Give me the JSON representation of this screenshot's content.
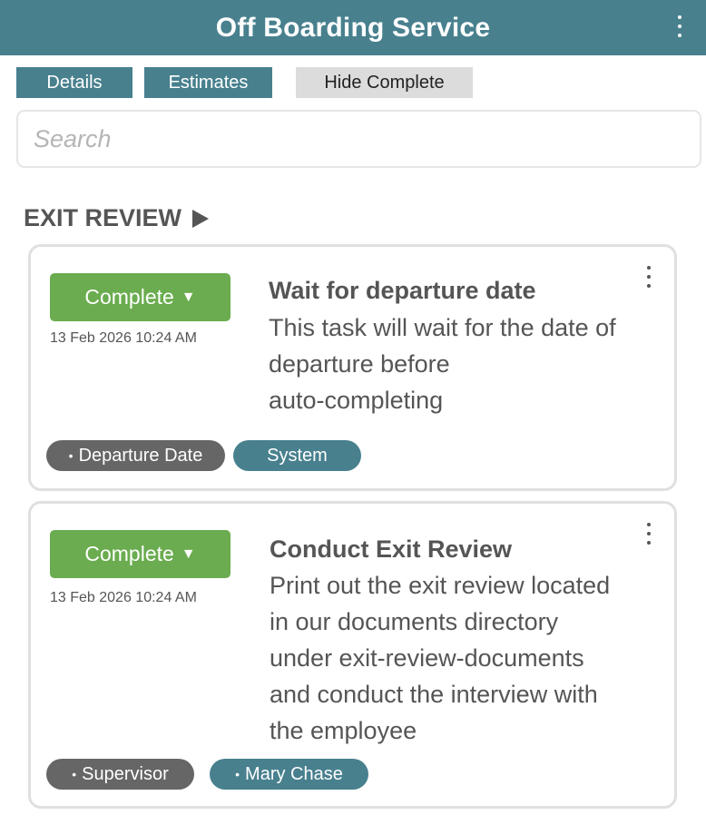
{
  "app": {
    "title": "Off Boarding Service"
  },
  "toolbar": {
    "details_label": "Details",
    "estimates_label": "Estimates",
    "hide_complete_label": "Hide Complete"
  },
  "search": {
    "placeholder": "Search",
    "value": ""
  },
  "section": {
    "title": "EXIT REVIEW"
  },
  "tasks": [
    {
      "status": "Complete",
      "timestamp": "13 Feb 2026 10:24 AM",
      "title": "Wait for departure date",
      "description_lines": [
        "This task will wait for the date of",
        "departure before",
        "auto-completing"
      ],
      "tags": [
        {
          "label": "Departure Date",
          "bullet": true,
          "style": "gray"
        },
        {
          "label": "System",
          "bullet": false,
          "style": "teal"
        }
      ]
    },
    {
      "status": "Complete",
      "timestamp": "13 Feb 2026 10:24 AM",
      "title": "Conduct Exit Review",
      "description_lines": [
        "Print out the exit review located",
        "in our documents directory",
        "under exit-review-documents",
        "and conduct the interview with",
        "the employee"
      ],
      "tags": [
        {
          "label": "Supervisor",
          "bullet": true,
          "style": "gray"
        },
        {
          "label": "Mary Chase",
          "bullet": true,
          "style": "teal"
        }
      ]
    }
  ],
  "colors": {
    "header": "#48808e",
    "status_complete": "#6aac4f",
    "chip_gray": "#666666",
    "chip_teal": "#48808e",
    "toolbar_light": "#dcdcdc"
  },
  "icons": {
    "menu": "more-vertical-icon",
    "section_toggle": "triangle-right-icon",
    "status_dropdown": "caret-down-icon",
    "tag_bullet": "bullet-icon"
  }
}
